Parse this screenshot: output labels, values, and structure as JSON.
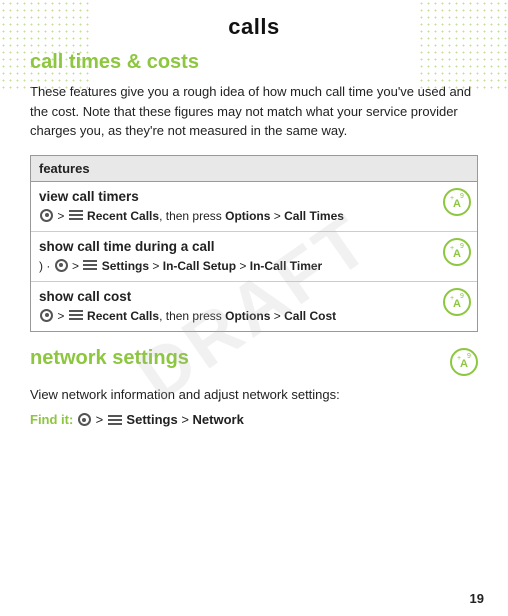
{
  "page": {
    "title": "calls",
    "page_number": "19",
    "draft_label": "DRAFT"
  },
  "section_calls": {
    "heading": "call times & costs",
    "intro": "These features give you a rough idea of how much call time you've used and the cost. Note that these figures may not match what your service provider charges you, as they're not measured in the same way.",
    "table": {
      "header": "features",
      "rows": [
        {
          "title": "view call timers",
          "instruction_parts": [
            {
              "type": "dot-icon"
            },
            {
              "type": "text",
              "value": " > "
            },
            {
              "type": "grid-icon"
            },
            {
              "type": "text",
              "value": " "
            },
            {
              "type": "bold",
              "value": "Recent Calls"
            },
            {
              "type": "text",
              "value": ", then press "
            },
            {
              "type": "bold",
              "value": "Options"
            },
            {
              "type": "text",
              "value": " > "
            },
            {
              "type": "bold",
              "value": "Call Times"
            }
          ]
        },
        {
          "title": "show call time during a call",
          "instruction_parts": [
            {
              "type": "text",
              "value": ") ·"
            },
            {
              "type": "dot-icon"
            },
            {
              "type": "text",
              "value": " > "
            },
            {
              "type": "grid-icon"
            },
            {
              "type": "text",
              "value": " "
            },
            {
              "type": "bold",
              "value": "Settings"
            },
            {
              "type": "text",
              "value": " > "
            },
            {
              "type": "bold",
              "value": "In-Call Setup"
            },
            {
              "type": "text",
              "value": " > "
            },
            {
              "type": "bold",
              "value": "In-Call Timer"
            }
          ]
        },
        {
          "title": "show call cost",
          "instruction_parts": [
            {
              "type": "dot-icon"
            },
            {
              "type": "text",
              "value": " > "
            },
            {
              "type": "grid-icon"
            },
            {
              "type": "text",
              "value": " "
            },
            {
              "type": "bold",
              "value": "Recent Calls"
            },
            {
              "type": "text",
              "value": ", then press "
            },
            {
              "type": "bold",
              "value": "Options"
            },
            {
              "type": "text",
              "value": " > "
            },
            {
              "type": "bold",
              "value": "Call Cost"
            }
          ]
        }
      ]
    }
  },
  "section_network": {
    "heading": "network settings",
    "intro": "View network information and adjust network settings:",
    "find_it_label": "Find it:",
    "find_it_instruction_parts": [
      {
        "type": "dot-icon"
      },
      {
        "type": "text",
        "value": " > "
      },
      {
        "type": "grid-icon"
      },
      {
        "type": "text",
        "value": " "
      },
      {
        "type": "bold",
        "value": "Settings"
      },
      {
        "type": "text",
        "value": " > "
      },
      {
        "type": "bold",
        "value": "Network"
      }
    ]
  }
}
